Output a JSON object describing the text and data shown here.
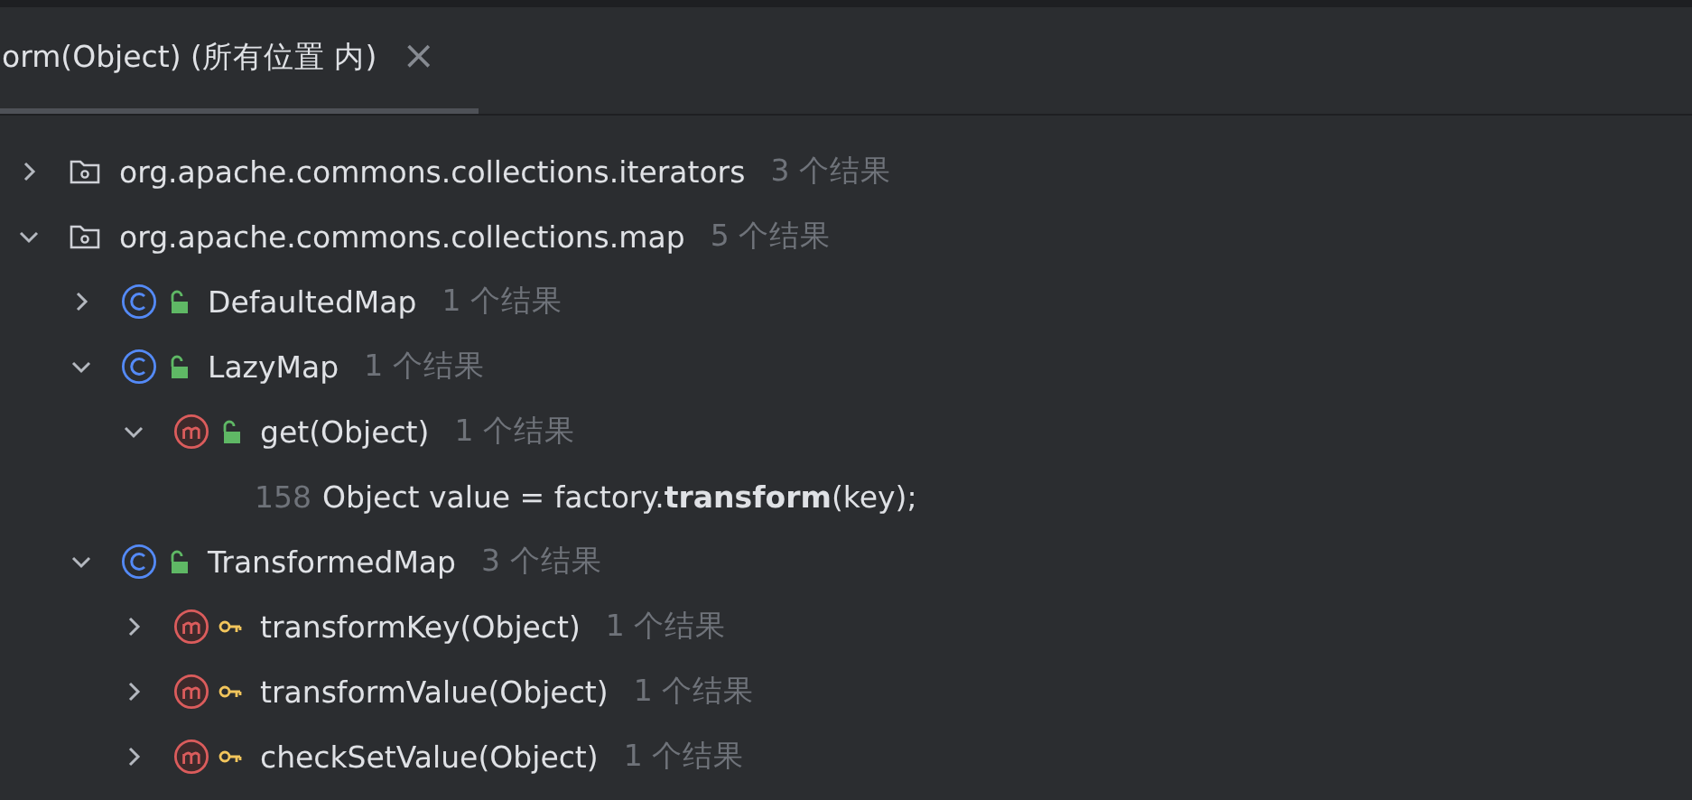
{
  "tab": {
    "title": "orm(Object) (所有位置 内)",
    "close": "×",
    "selected": true
  },
  "tree": [
    {
      "kind": "package",
      "label": "org.apache.commons.collections.iterators",
      "count": "3 个结果",
      "expanded": false
    },
    {
      "kind": "package",
      "label": "org.apache.commons.collections.map",
      "count": "5 个结果",
      "expanded": true,
      "children": [
        {
          "kind": "class",
          "protected": false,
          "label": "DefaultedMap",
          "count": "1 个结果",
          "expanded": false
        },
        {
          "kind": "class",
          "protected": false,
          "label": "LazyMap",
          "count": "1 个结果",
          "expanded": true,
          "children": [
            {
              "kind": "method",
              "protected": false,
              "label": "get(Object)",
              "count": "1 个结果",
              "expanded": true,
              "children": [
                {
                  "kind": "usage",
                  "line": "158",
                  "code": "Object value = factory.**transform**(key);"
                }
              ]
            }
          ]
        },
        {
          "kind": "class",
          "protected": false,
          "label": "TransformedMap",
          "count": "3 个结果",
          "expanded": true,
          "children": [
            {
              "kind": "method",
              "protected": true,
              "label": "transformKey(Object)",
              "count": "1 个结果",
              "expanded": false
            },
            {
              "kind": "method",
              "protected": true,
              "label": "transformValue(Object)",
              "count": "1 个结果",
              "expanded": false
            },
            {
              "kind": "method",
              "protected": true,
              "label": "checkSetValue(Object)",
              "count": "1 个结果",
              "expanded": false
            }
          ]
        }
      ]
    }
  ]
}
